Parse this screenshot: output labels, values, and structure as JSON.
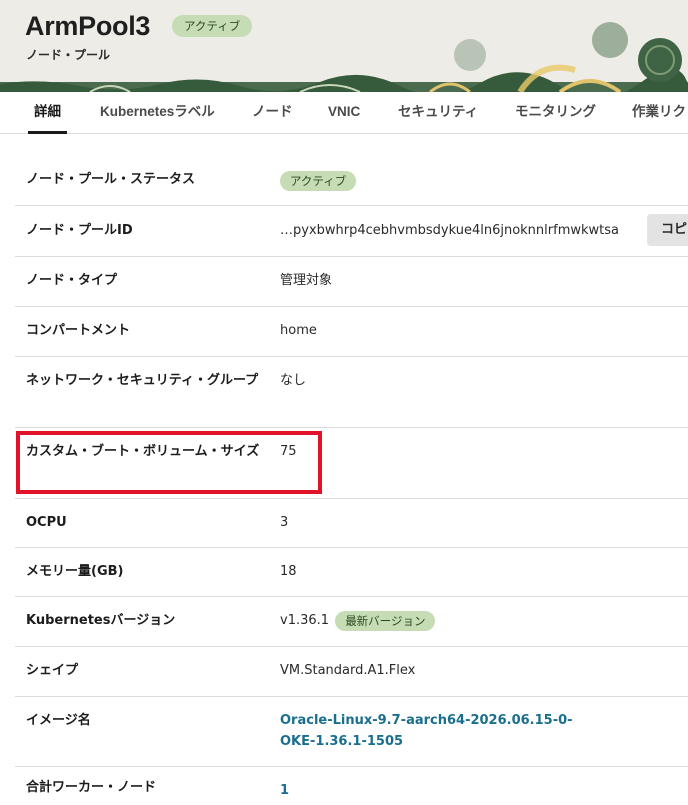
{
  "header": {
    "title": "ArmPool3",
    "status_badge": "アクティブ",
    "subtitle": "ノード・プール"
  },
  "tabs": [
    {
      "label": "詳細",
      "active": true
    },
    {
      "label": "Kubernetesラベル",
      "active": false
    },
    {
      "label": "ノード",
      "active": false
    },
    {
      "label": "VNIC",
      "active": false
    },
    {
      "label": "セキュリティ",
      "active": false
    },
    {
      "label": "モニタリング",
      "active": false
    },
    {
      "label": "作業リク",
      "active": false
    }
  ],
  "details": {
    "status": {
      "label": "ノード・プール・ステータス",
      "value": "アクティブ"
    },
    "pool_id": {
      "label": "ノード・プールID",
      "value": "…pyxbwhrp4cebhvmbsdykue4ln6jnoknnlrfmwkwtsa",
      "copy_label": "コピー"
    },
    "node_type": {
      "label": "ノード・タイプ",
      "value": "管理対象"
    },
    "compartment": {
      "label": "コンパートメント",
      "value": "home"
    },
    "nsg": {
      "label": "ネットワーク・セキュリティ・グループ",
      "value": "なし"
    },
    "boot_volume": {
      "label": "カスタム・ブート・ボリューム・サイズ",
      "value": "75"
    },
    "ocpu": {
      "label": "OCPU",
      "value": "3"
    },
    "memory": {
      "label": "メモリー量(GB)",
      "value": "18"
    },
    "k8s_version": {
      "label": "Kubernetesバージョン",
      "value": "v1.36.1",
      "badge": "最新バージョン"
    },
    "shape": {
      "label": "シェイプ",
      "value": "VM.Standard.A1.Flex"
    },
    "image": {
      "label": "イメージ名",
      "value": "Oracle-Linux-9.7-aarch64-2026.06.15-0-OKE-1.36.1-1505"
    },
    "total_workers": {
      "label": "合計ワーカー・ノード",
      "value": "1"
    }
  },
  "colors": {
    "active_badge_bg": "#c6dcb4",
    "link": "#1a6f8e",
    "highlight_border": "#e1122a"
  }
}
